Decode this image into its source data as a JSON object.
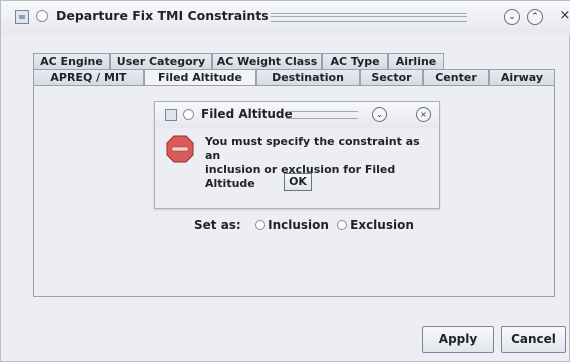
{
  "window": {
    "title": "Departure Fix TMI Constraints",
    "controls": {
      "minimize": "⌄",
      "maximize": "⌃",
      "close": "×"
    }
  },
  "tabs": {
    "row_top": [
      {
        "label": "AC Engine"
      },
      {
        "label": "User Category"
      },
      {
        "label": "AC Weight Class"
      },
      {
        "label": "AC Type"
      },
      {
        "label": "Airline"
      }
    ],
    "row_bottom": [
      {
        "label": "APREQ / MIT"
      },
      {
        "label": "Filed Altitude",
        "selected": true
      },
      {
        "label": "Destination"
      },
      {
        "label": "Sector"
      },
      {
        "label": "Center"
      },
      {
        "label": "Airway"
      }
    ]
  },
  "dialog": {
    "title": "Filed Altitude",
    "controls": {
      "minimize": "⌄",
      "close": "×"
    },
    "icon": "stop-sign-icon",
    "message_line1": "You must specify the constraint as an",
    "message_line2": "inclusion or exclusion for Filed Altitude",
    "ok_label": "OK"
  },
  "set_as": {
    "label": "Set as:",
    "options": [
      {
        "label": "Inclusion",
        "selected": false
      },
      {
        "label": "Exclusion",
        "selected": false
      }
    ]
  },
  "footer": {
    "apply_label": "Apply",
    "cancel_label": "Cancel"
  },
  "colors": {
    "window_bg": "#eceef3",
    "stop_red": "#d75c57",
    "stop_dark": "#9e2f2a"
  }
}
